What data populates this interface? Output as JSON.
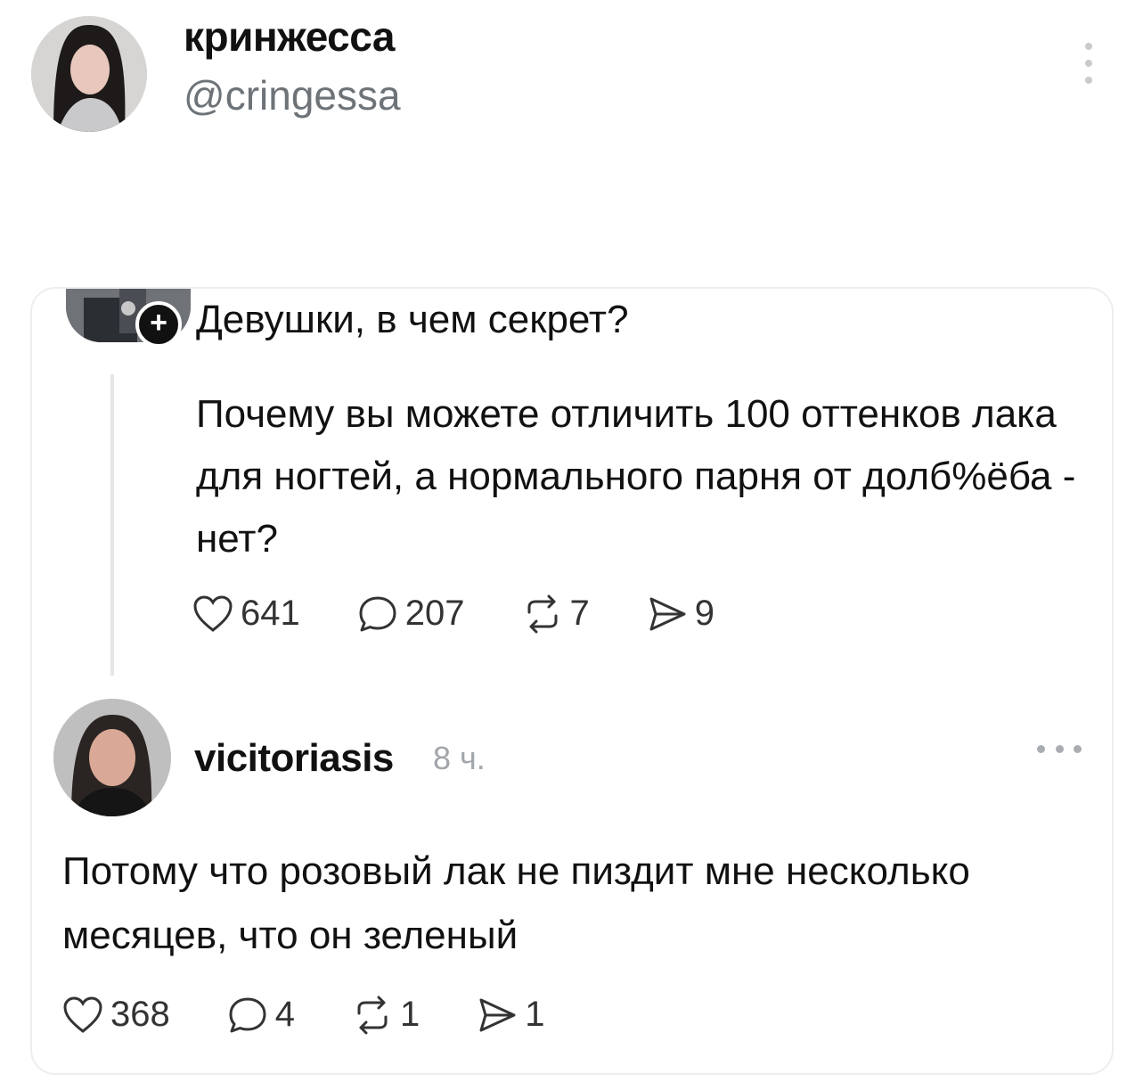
{
  "author": {
    "name": "кринжесса",
    "handle": "@cringessa"
  },
  "quote": {
    "title": "Девушки, в чем секрет?",
    "body": "Почему вы  можете  отличить 100 оттенков лака для ногтей, а нормального парня от долб%ёба - нет?",
    "follow_label": "+",
    "stats": {
      "likes": "641",
      "comments": "207",
      "reposts": "7",
      "shares": "9"
    }
  },
  "reply": {
    "username": "vicitoriasis",
    "time": "8 ч.",
    "body": "Потому что розовый лак не пиздит мне несколько месяцев, что он зеленый",
    "stats": {
      "likes": "368",
      "comments": "4",
      "reposts": "1",
      "shares": "1"
    }
  }
}
